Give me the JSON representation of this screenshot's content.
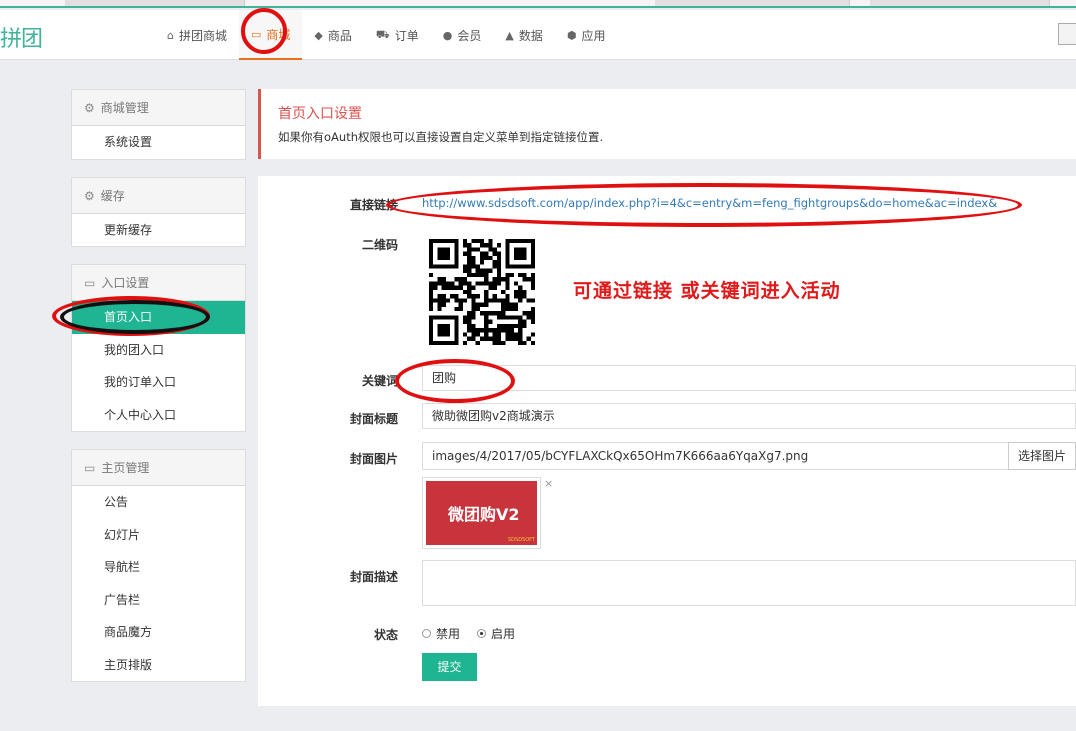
{
  "header": {
    "logo": "拼团",
    "nav": [
      {
        "label": "拼团商城",
        "icon": "home-icon",
        "glyph": "⌂"
      },
      {
        "label": "商城",
        "icon": "monitor-icon",
        "glyph": "▭"
      },
      {
        "label": "商品",
        "icon": "gift-icon",
        "glyph": "◆"
      },
      {
        "label": "订单",
        "icon": "cart-icon",
        "glyph": "⛟"
      },
      {
        "label": "会员",
        "icon": "user-icon",
        "glyph": "●"
      },
      {
        "label": "数据",
        "icon": "chart-icon",
        "glyph": "▲"
      },
      {
        "label": "应用",
        "icon": "cubes-icon",
        "glyph": "⬢"
      }
    ],
    "active_nav": "商城"
  },
  "sidebar": {
    "groups": [
      {
        "title": "商城管理",
        "icon": "gear-icon",
        "items": [
          "系统设置"
        ]
      },
      {
        "title": "缓存",
        "icon": "gear-icon",
        "items": [
          "更新缓存"
        ]
      },
      {
        "title": "入口设置",
        "icon": "inbox-icon",
        "items": [
          "首页入口",
          "我的团入口",
          "我的订单入口",
          "个人中心入口"
        ]
      },
      {
        "title": "主页管理",
        "icon": "inbox-icon",
        "items": [
          "公告",
          "幻灯片",
          "导航栏",
          "广告栏",
          "商品魔方",
          "主页排版"
        ]
      }
    ],
    "active_item": "首页入口"
  },
  "content": {
    "title": "首页入口设置",
    "description": "如果你有oAuth权限也可以直接设置自定义菜单到指定链接位置.",
    "form": {
      "link_label": "直接链接",
      "link_value": "http://www.sdsdsoft.com/app/index.php?i=4&c=entry&m=feng_fightgroups&do=home&ac=index&",
      "qrcode_label": "二维码",
      "keyword_label": "关键词",
      "keyword_value": "团购",
      "cover_title_label": "封面标题",
      "cover_title_value": "微助微团购v2商城演示",
      "cover_image_label": "封面图片",
      "cover_image_value": "images/4/2017/05/bCYFLAXCkQx65OHm7K666aa6YqaXg7.png",
      "select_image_button": "选择图片",
      "thumbnail_text": "微团购V2",
      "thumbnail_brand": "SDSDSOFT",
      "remove_icon": "×",
      "cover_desc_label": "封面描述",
      "cover_desc_value": "",
      "status_label": "状态",
      "status_options": [
        "禁用",
        "启用"
      ],
      "status_selected": "启用",
      "submit_button": "提交"
    },
    "annotation_text": "可通过链接  或关键词进入活动"
  },
  "colors": {
    "accent": "#1fb492",
    "nav_active": "#e8711d",
    "title_red": "#d9534f",
    "annotation_red": "#e01a1a",
    "link": "#337ab7"
  }
}
